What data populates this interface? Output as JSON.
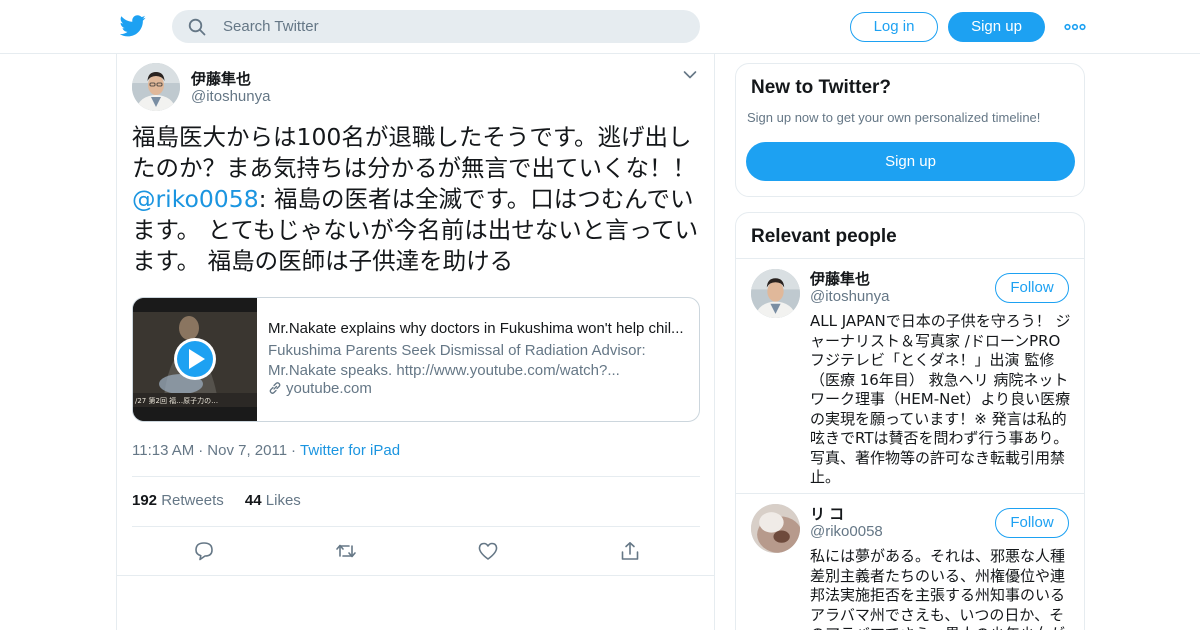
{
  "header": {
    "search_placeholder": "Search Twitter",
    "login_label": "Log in",
    "signup_label": "Sign up",
    "brand_color": "#1da1f2"
  },
  "tweet": {
    "author_name": "伊藤隼也",
    "author_handle": "@itoshunya",
    "text_part1": "福島医大からは100名が退職したそうです。逃げ出したのか？まあ気持ちは分かるが無言で出ていくな！！ ",
    "mention": "@riko0058",
    "text_part2": ": 福島の医者は全滅です。口はつむんでいます。 とてもじゃないが今名前は出せないと言っています。 福島の医師は子供達を助ける",
    "card": {
      "title": "Mr.Nakate explains why doctors in Fukushima won't help chil...",
      "description": "Fukushima Parents Seek Dismissal of Radiation Advisor: Mr.Nakate speaks. http://www.youtube.com/watch?...",
      "domain": "youtube.com"
    },
    "time": "11:13 AM",
    "date": "Nov 7, 2011",
    "source": "Twitter for iPad",
    "retweets_count": "192",
    "retweets_label": "Retweets",
    "likes_count": "44",
    "likes_label": "Likes",
    "icons": [
      "reply-icon",
      "retweet-icon",
      "like-icon",
      "share-icon"
    ]
  },
  "sidebar": {
    "new_title": "New to Twitter?",
    "new_subtitle": "Sign up now to get your own personalized timeline!",
    "new_button": "Sign up",
    "relevant_title": "Relevant people",
    "people": [
      {
        "name": "伊藤隼也",
        "handle": "@itoshunya",
        "follow_label": "Follow",
        "bio": "ALL JAPANで日本の子供を守ろう！ ジャーナリスト＆写真家 /ドローンPRO フジテレビ「とくダネ！」出演 監修（医療 16年目） 救急ヘリ 病院ネットワーク理事（HEM-Net）より良い医療の実現を願っています！※ 発言は私的呟きでRTは賛否を問わず行う事あり。写真、著作物等の許可なき転載引用禁止。"
      },
      {
        "name": "リ コ",
        "handle": "@riko0058",
        "follow_label": "Follow",
        "bio": "私には夢がある。それは、邪悪な人種差別主義者たちのいる、州権優位や連邦法実施拒否を主張する州知事のいるアラバマ州でさえも、いつの日か、そのアラバマでさえ、黒人の少年少女が"
      }
    ]
  }
}
